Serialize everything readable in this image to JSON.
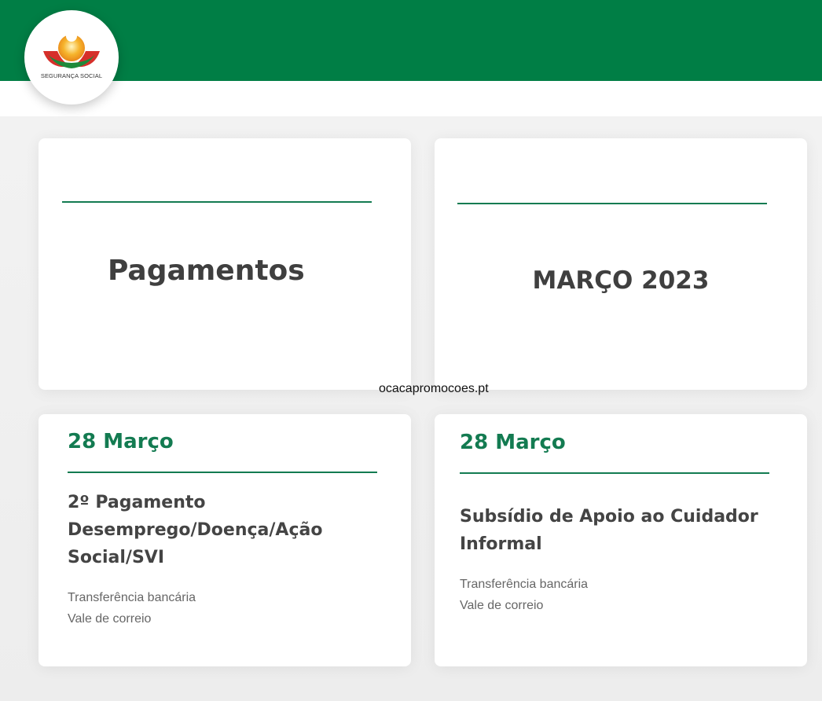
{
  "brand": {
    "logo_text": "SEGURANÇA SOCIAL",
    "header_color": "#007e45",
    "accent_color": "#137b51"
  },
  "header_cards": {
    "left_title": "Pagamentos",
    "right_title": "MARÇO 2023"
  },
  "payments": [
    {
      "date": "28 Março",
      "title_lines": [
        "2º Pagamento",
        "Desemprego/Doença/Ação",
        "Social/SVI"
      ],
      "methods": [
        "Transferência bancária",
        "Vale de correio"
      ]
    },
    {
      "date": "28 Março",
      "title_lines": [
        "Subsídio de Apoio ao Cuidador",
        "Informal"
      ],
      "methods": [
        "Transferência bancária",
        "Vale de correio"
      ]
    }
  ],
  "watermark": "ocacapromocoes.pt"
}
